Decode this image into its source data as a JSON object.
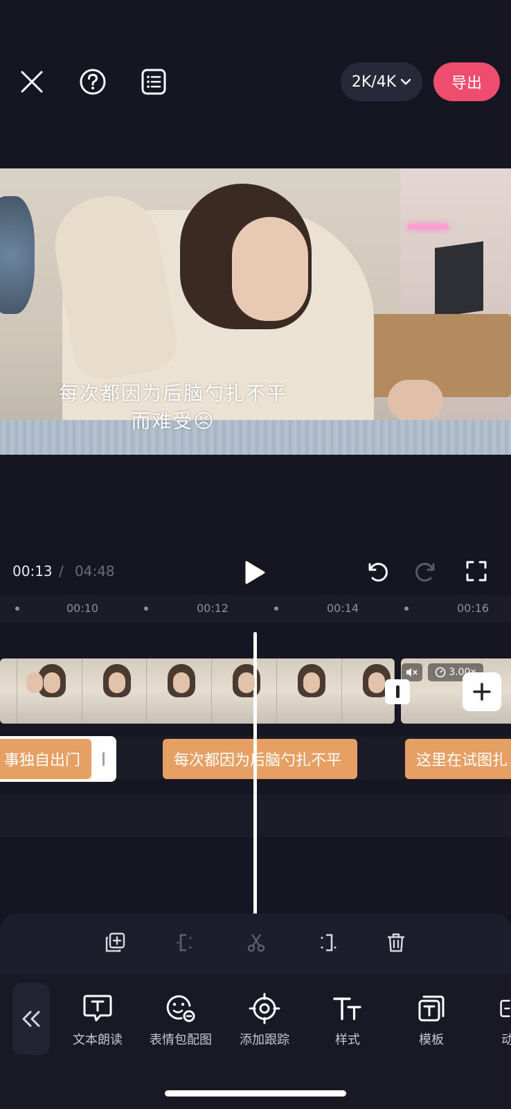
{
  "topbar": {
    "close_icon": "close-icon",
    "help_icon": "help-icon",
    "list_icon": "list-icon",
    "resolution_label": "2K/4K",
    "export_label": "导出",
    "export_color": "#ee4d6f"
  },
  "preview": {
    "caption_line1": "每次都因为后脑勺扎不平",
    "caption_line2": "而难受😣"
  },
  "playback": {
    "current_time": "00:13",
    "separator": "/",
    "total_time": "04:48"
  },
  "ruler": {
    "ticks": [
      "00:10",
      "00:12",
      "00:14",
      "00:16"
    ]
  },
  "video_track": {
    "speed_label": "3.00x"
  },
  "text_track": {
    "clips": [
      "事独自出门",
      "每次都因为后脑勺扎不平",
      "这里在试图扎"
    ]
  },
  "toolbar": {
    "items": [
      {
        "label": "文本朗读",
        "icon": "text-to-speech-icon"
      },
      {
        "label": "表情包配图",
        "icon": "sticker-icon"
      },
      {
        "label": "添加跟踪",
        "icon": "tracking-icon"
      },
      {
        "label": "样式",
        "icon": "style-icon"
      },
      {
        "label": "模板",
        "icon": "template-icon"
      },
      {
        "label": "动",
        "icon": "animation-icon"
      }
    ]
  }
}
